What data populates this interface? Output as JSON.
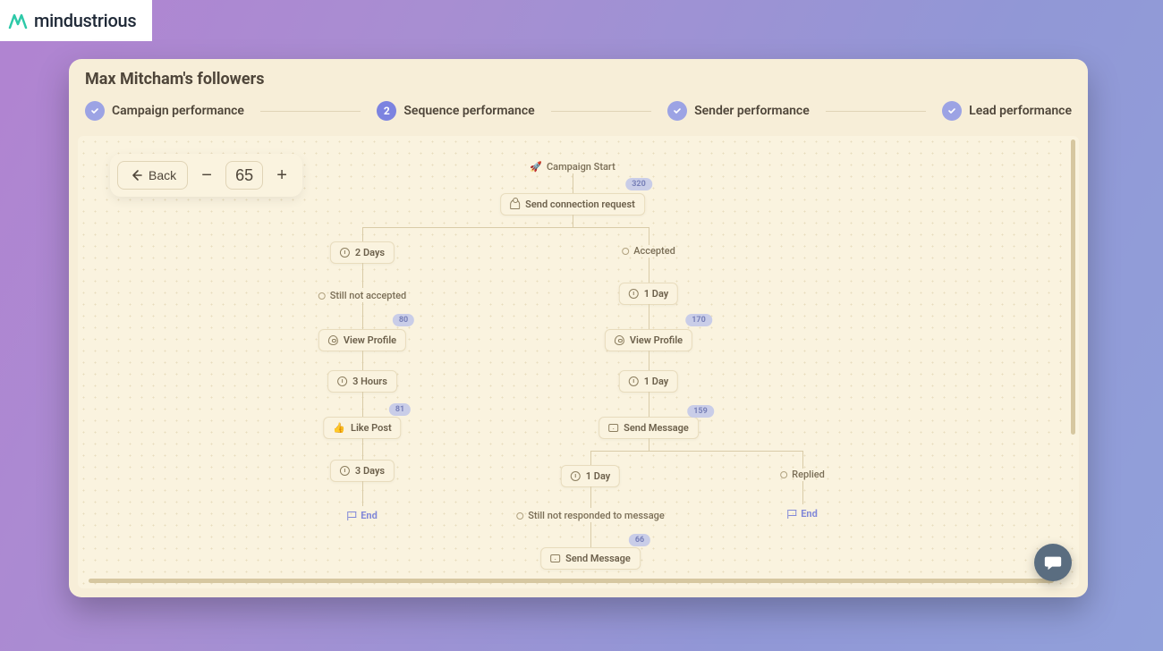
{
  "logo": {
    "name": "mindustrious"
  },
  "title": "Max Mitcham's followers",
  "steps": [
    {
      "label": "Campaign performance",
      "active": false
    },
    {
      "label": "Sequence performance",
      "active": true,
      "num": "2"
    },
    {
      "label": "Sender performance",
      "active": false
    },
    {
      "label": "Lead performance",
      "active": false
    }
  ],
  "toolbar": {
    "back_label": "Back",
    "zoom": "65"
  },
  "flow": {
    "start": "Campaign Start",
    "send_conn": "Send connection request",
    "two_days": "2 Days",
    "accepted": "Accepted",
    "not_accepted": "Still not accepted",
    "one_day": "1 Day",
    "view_profile": "View Profile",
    "three_hours": "3 Hours",
    "like_post": "Like Post",
    "three_days": "3 Days",
    "send_msg": "Send Message",
    "replied": "Replied",
    "not_responded": "Still not responded to message",
    "end": "End",
    "badges": {
      "b1": "320",
      "b2": "80",
      "b3": "81",
      "b4": "170",
      "b5": "159",
      "b6": "66"
    }
  }
}
